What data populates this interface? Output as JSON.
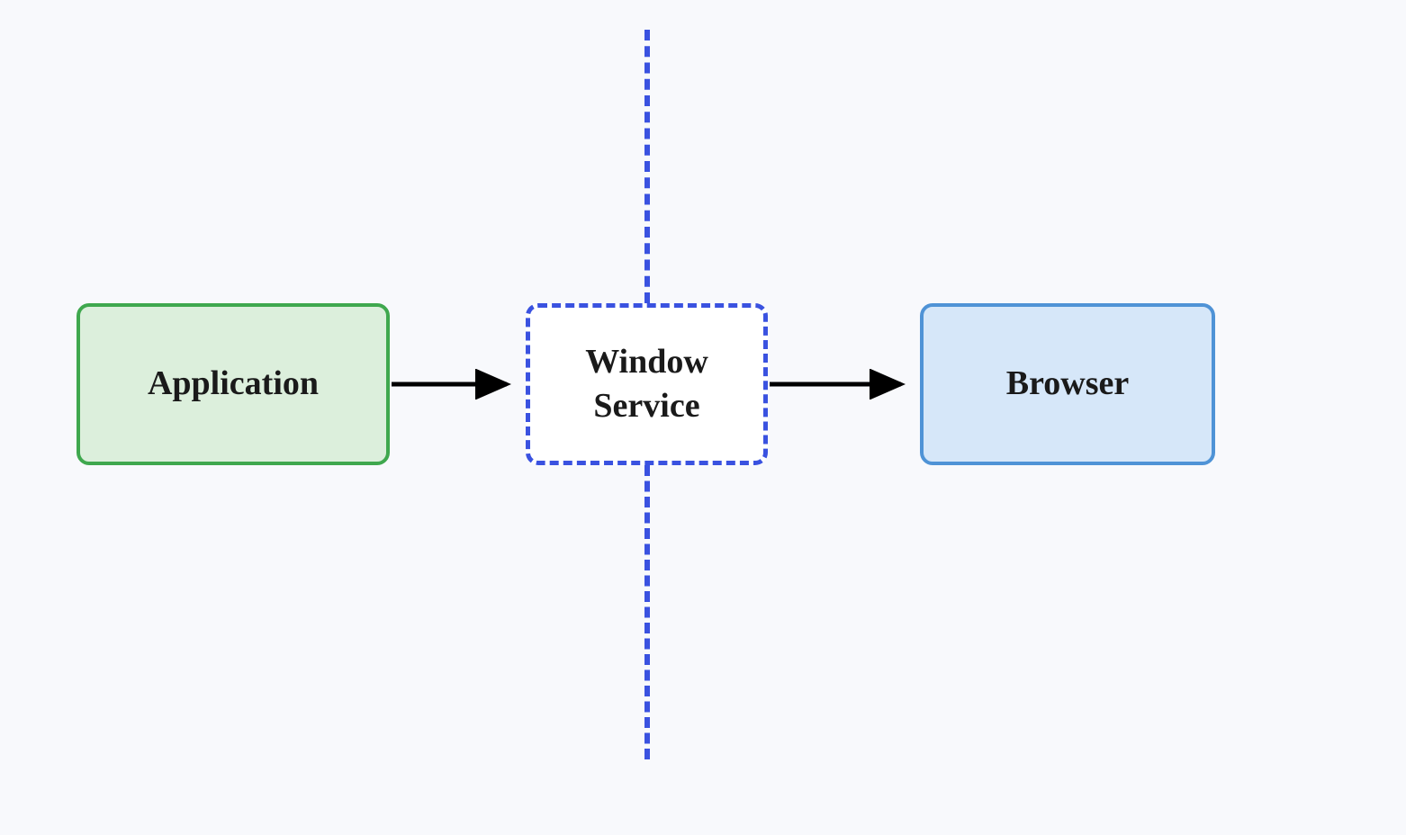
{
  "diagram": {
    "nodes": {
      "application": {
        "label": "Application",
        "style": "solid",
        "fill": "#dcefdc",
        "border": "#3fa84e"
      },
      "window_service": {
        "label": "Window Service",
        "style": "dashed",
        "fill": "#ffffff",
        "border": "#3a52e0"
      },
      "browser": {
        "label": "Browser",
        "style": "solid",
        "fill": "#d6e7f9",
        "border": "#4f93d6"
      }
    },
    "edges": [
      {
        "from": "application",
        "to": "window_service"
      },
      {
        "from": "window_service",
        "to": "browser"
      }
    ],
    "divider": {
      "orientation": "vertical",
      "color": "#3a52e0",
      "style": "dashed"
    }
  }
}
